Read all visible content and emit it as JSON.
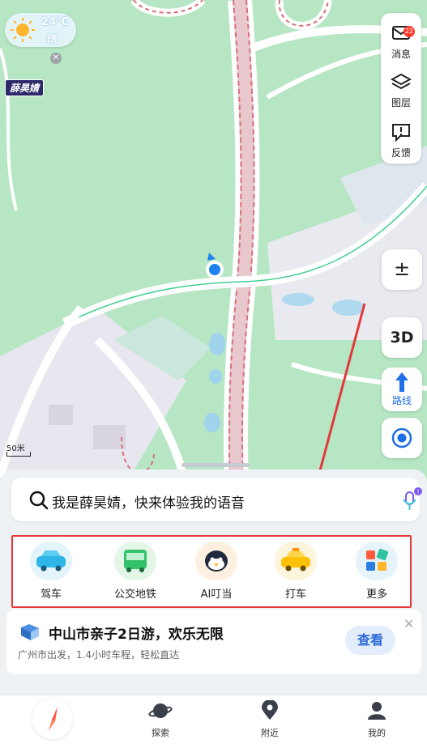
{
  "weather": {
    "temp": "24°C",
    "condition": "晴"
  },
  "user_tag": "薛昊婧",
  "right_panel": {
    "messages": {
      "label": "消息",
      "badge": "22"
    },
    "layers": {
      "label": "图层"
    },
    "feedback": {
      "label": "反馈"
    }
  },
  "map_controls": {
    "zoom": "±",
    "three_d": "3D",
    "route": "路线"
  },
  "scale_label": "50米",
  "search": {
    "text": "我是薛昊婧，快来体验我的语音"
  },
  "quick_actions": [
    {
      "label": "驾车",
      "icon": "car-icon"
    },
    {
      "label": "公交地铁",
      "icon": "bus-icon"
    },
    {
      "label": "AI叮当",
      "icon": "ai-assistant-icon"
    },
    {
      "label": "打车",
      "icon": "taxi-icon"
    },
    {
      "label": "更多",
      "icon": "more-apps-icon"
    }
  ],
  "promo": {
    "title": "中山市亲子2日游，欢乐无限",
    "subtitle": "广州市出发，1.4小时车程，轻松直达",
    "button": "查看"
  },
  "bottom_nav": [
    {
      "label": "",
      "icon": "compass-icon"
    },
    {
      "label": "探索",
      "icon": "planet-icon"
    },
    {
      "label": "附近",
      "icon": "location-pin-icon"
    },
    {
      "label": "我的",
      "icon": "user-icon"
    }
  ],
  "colors": {
    "map_green": "#b6e6c3",
    "road": "#ffffff",
    "accent": "#1e6fe8",
    "highlight": "#e3393c"
  }
}
